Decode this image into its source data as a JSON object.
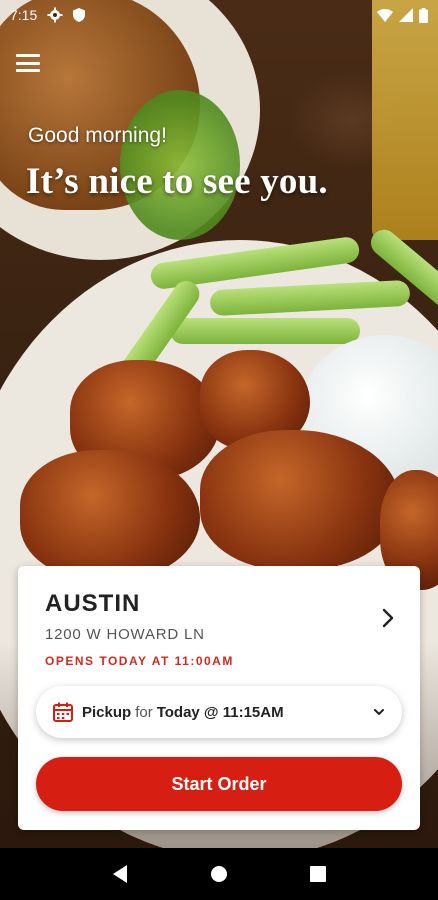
{
  "status_bar": {
    "time": "7:15",
    "icons": [
      "gear-icon",
      "shield-icon",
      "wifi-icon",
      "signal-icon",
      "battery-icon"
    ]
  },
  "header": {
    "menu_icon": "hamburger-menu-icon",
    "greeting": "Good morning!",
    "headline": "It’s nice to see you."
  },
  "location": {
    "city": "AUSTIN",
    "address": "1200 W HOWARD LN",
    "hours": "OPENS TODAY AT 11:00AM",
    "chevron_icon": "chevron-right-icon"
  },
  "pickup": {
    "icon": "calendar-icon",
    "mode": "Pickup",
    "for_text": "for",
    "time": "Today @ 11:15AM",
    "caret_icon": "chevron-down-icon"
  },
  "actions": {
    "start_order_label": "Start Order"
  },
  "nav_bar": {
    "icons": [
      "back-icon",
      "home-icon",
      "recents-icon"
    ]
  },
  "colors": {
    "accent": "#d61f12",
    "hours_text": "#d42a1e"
  }
}
